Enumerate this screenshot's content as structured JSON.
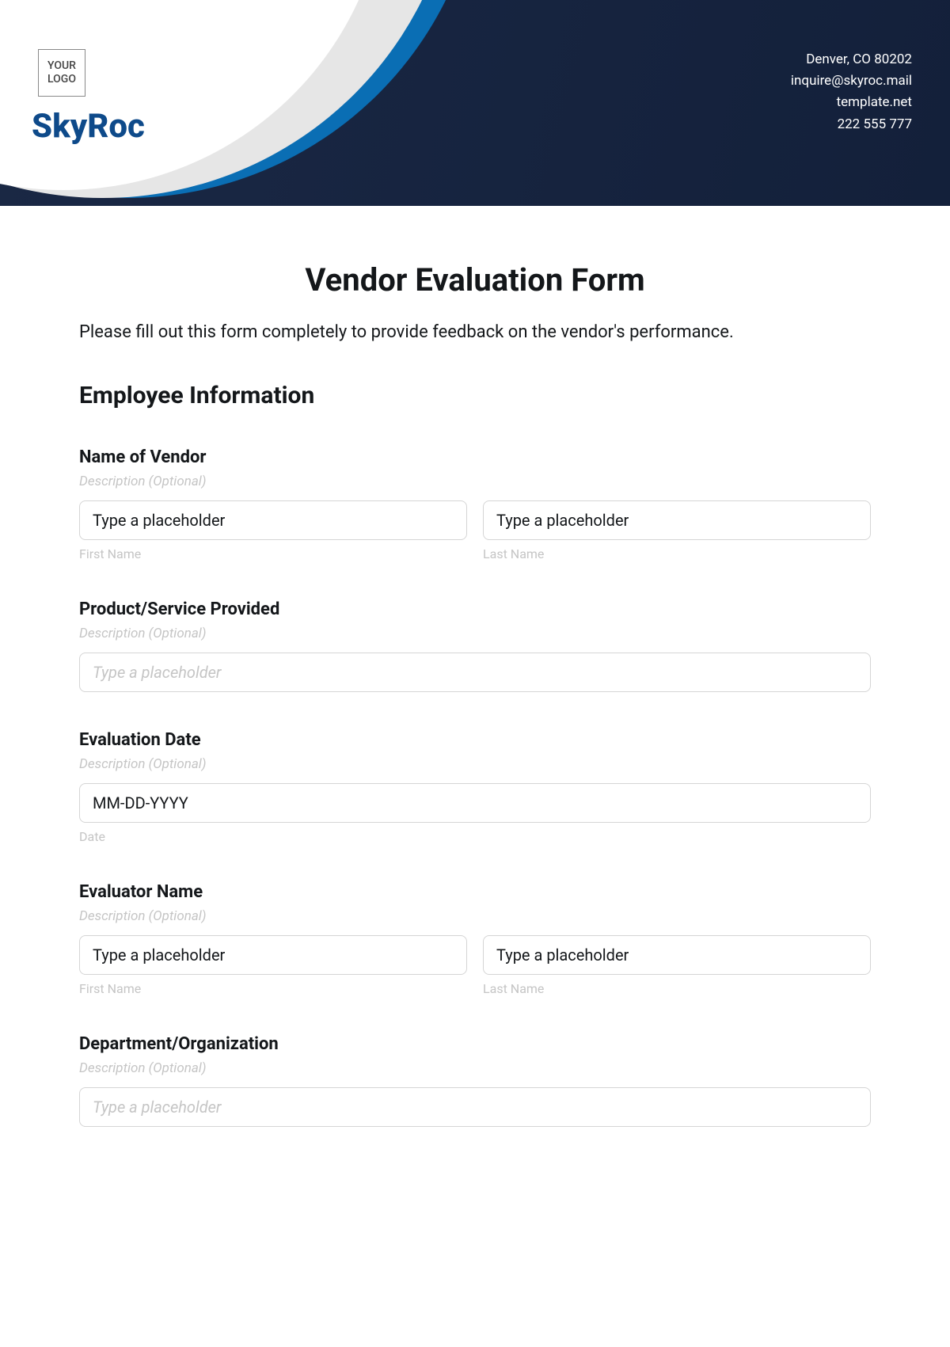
{
  "header": {
    "logo_text": "YOUR LOGO",
    "company_name": "SkyRoc",
    "address": "Denver, CO 80202",
    "email": "inquire@skyroc.mail",
    "website": "template.net",
    "phone": "222 555 777"
  },
  "form": {
    "title": "Vendor Evaluation Form",
    "subtitle": "Please fill out this form completely to provide feedback on the vendor's performance.",
    "section_title": "Employee Information",
    "fields": {
      "vendor_name": {
        "label": "Name of Vendor",
        "desc": "Description (Optional)",
        "first_placeholder": "Type a placeholder",
        "first_sublabel": "First Name",
        "last_placeholder": "Type a placeholder",
        "last_sublabel": "Last Name"
      },
      "product_service": {
        "label": "Product/Service Provided",
        "desc": "Description (Optional)",
        "placeholder": "Type a placeholder"
      },
      "evaluation_date": {
        "label": "Evaluation Date",
        "desc": "Description (Optional)",
        "placeholder": "MM-DD-YYYY",
        "sublabel": "Date"
      },
      "evaluator_name": {
        "label": "Evaluator Name",
        "desc": "Description (Optional)",
        "first_placeholder": "Type a placeholder",
        "first_sublabel": "First Name",
        "last_placeholder": "Type a placeholder",
        "last_sublabel": "Last Name"
      },
      "department": {
        "label": "Department/Organization",
        "desc": "Description (Optional)",
        "placeholder": "Type a placeholder"
      }
    }
  }
}
